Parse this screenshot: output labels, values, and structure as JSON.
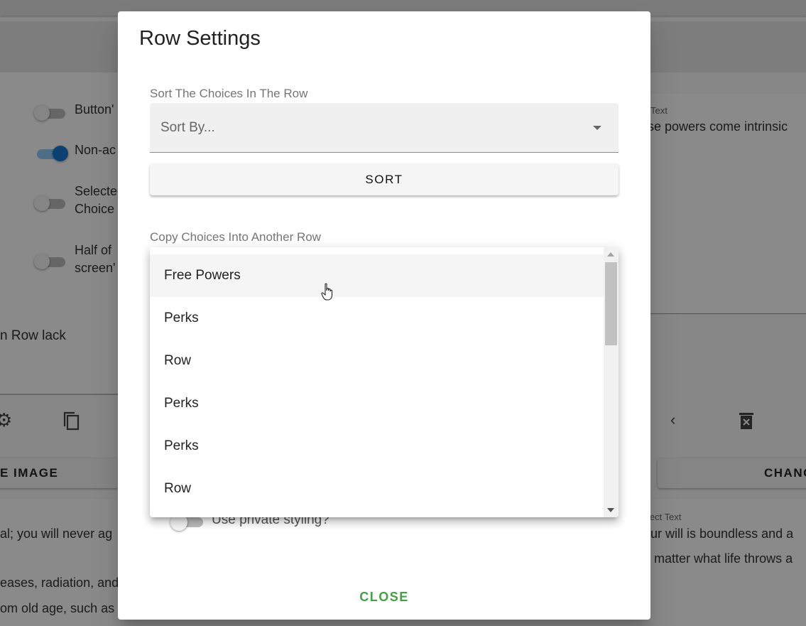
{
  "background": {
    "toggles": [
      {
        "label": "Button'",
        "on": false
      },
      {
        "label": "Non-ac",
        "on": true
      },
      {
        "label": "Selecte",
        "label2": "Choice",
        "on": false
      },
      {
        "label": "Half of",
        "label2": "screen'",
        "on": false
      }
    ],
    "row_lack_text": "n Row lack",
    "right_label": "Text",
    "right_text": "ese powers come intrinsic",
    "image_button": "E IMAGE",
    "change_button": "CHANG",
    "bottom_left_lines": [
      "al; you will never ag",
      "eases, radiation, and",
      "om old age, such as"
    ],
    "bottom_right_label": "ject Text",
    "bottom_right_lines": [
      "our will is boundless and a",
      "o matter what life throws a"
    ]
  },
  "dialog": {
    "title": "Row Settings",
    "sort_section_label": "Sort The Choices In The Row",
    "sort_placeholder": "Sort By...",
    "sort_button": "SORT",
    "copy_section_label": "Copy Choices Into Another Row",
    "private_styling_label": "Use private styling?",
    "close_button": "CLOSE"
  },
  "dropdown": {
    "items": [
      "Free Powers",
      "Perks",
      "Row",
      "Perks",
      "Perks",
      "Row"
    ],
    "hovered_index": 0
  },
  "colors": {
    "accent_green": "#43a047",
    "toggle_blue": "#1976d2"
  }
}
